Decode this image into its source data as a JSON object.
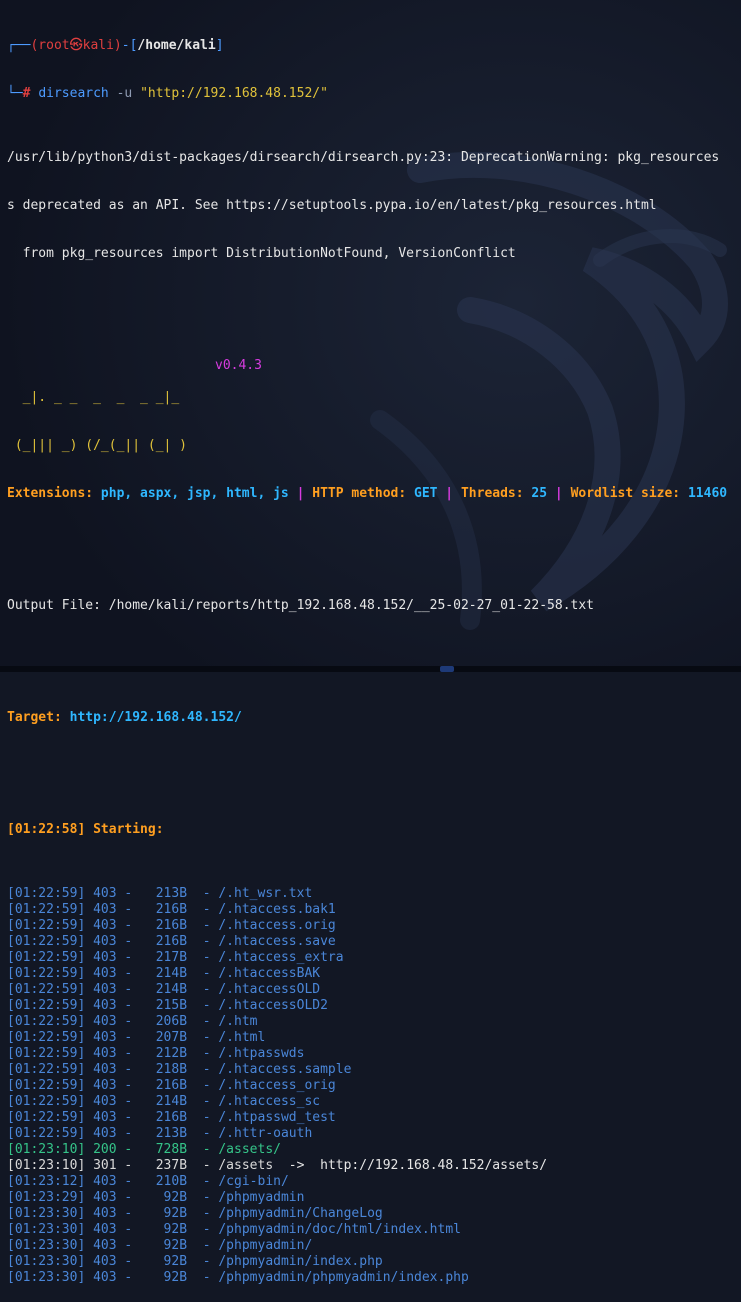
{
  "prompt": {
    "user": "(root㉿kali)",
    "dir": "/home/kali",
    "symbol": "#",
    "command_name": "dirsearch",
    "command_args": " -u ",
    "url_arg": "\"http://192.168.48.152/\""
  },
  "warning_lines": [
    "/usr/lib/python3/dist-packages/dirsearch/dirsearch.py:23: DeprecationWarning: pkg_resources",
    "s deprecated as an API. See https://setuptools.pypa.io/en/latest/pkg_resources.html",
    "  from pkg_resources import DistributionNotFound, VersionConflict"
  ],
  "banner": {
    "art": [
      "  _|. _ _  _  _  _ _|_",
      " (_||| _) (/_(_|| (_| )"
    ],
    "version": "v0.4.3"
  },
  "config": {
    "ext_label": "Extensions: ",
    "ext_value": "php, aspx, jsp, html, js",
    "sep": " | ",
    "method_label": "HTTP method: ",
    "method_value": "GET",
    "threads_label": "Threads: ",
    "threads_value": "25",
    "wordlist_label": "Wordlist size: ",
    "wordlist_value": "11460"
  },
  "output_file": "Output File: /home/kali/reports/http_192.168.48.152/__25-02-27_01-22-58.txt",
  "target": {
    "label": "Target: ",
    "url": "http://192.168.48.152/"
  },
  "starting": "[01:22:58] Starting:",
  "results": [
    {
      "time": "[01:22:59]",
      "code": "403",
      "size": " 213B",
      "path": "/.ht_wsr.txt"
    },
    {
      "time": "[01:22:59]",
      "code": "403",
      "size": " 216B",
      "path": "/.htaccess.bak1"
    },
    {
      "time": "[01:22:59]",
      "code": "403",
      "size": " 216B",
      "path": "/.htaccess.orig"
    },
    {
      "time": "[01:22:59]",
      "code": "403",
      "size": " 216B",
      "path": "/.htaccess.save"
    },
    {
      "time": "[01:22:59]",
      "code": "403",
      "size": " 217B",
      "path": "/.htaccess_extra"
    },
    {
      "time": "[01:22:59]",
      "code": "403",
      "size": " 214B",
      "path": "/.htaccessBAK"
    },
    {
      "time": "[01:22:59]",
      "code": "403",
      "size": " 214B",
      "path": "/.htaccessOLD"
    },
    {
      "time": "[01:22:59]",
      "code": "403",
      "size": " 215B",
      "path": "/.htaccessOLD2"
    },
    {
      "time": "[01:22:59]",
      "code": "403",
      "size": " 206B",
      "path": "/.htm"
    },
    {
      "time": "[01:22:59]",
      "code": "403",
      "size": " 207B",
      "path": "/.html"
    },
    {
      "time": "[01:22:59]",
      "code": "403",
      "size": " 212B",
      "path": "/.htpasswds"
    },
    {
      "time": "[01:22:59]",
      "code": "403",
      "size": " 218B",
      "path": "/.htaccess.sample"
    },
    {
      "time": "[01:22:59]",
      "code": "403",
      "size": " 216B",
      "path": "/.htaccess_orig"
    },
    {
      "time": "[01:22:59]",
      "code": "403",
      "size": " 214B",
      "path": "/.htaccess_sc"
    },
    {
      "time": "[01:22:59]",
      "code": "403",
      "size": " 216B",
      "path": "/.htpasswd_test"
    },
    {
      "time": "[01:22:59]",
      "code": "403",
      "size": " 213B",
      "path": "/.httr-oauth"
    },
    {
      "time": "[01:23:10]",
      "code": "200",
      "size": " 728B",
      "path": "/assets/"
    },
    {
      "time": "[01:23:10]",
      "code": "301",
      "size": " 237B",
      "path": "/assets",
      "redirect": "  ->  http://192.168.48.152/assets/"
    },
    {
      "time": "[01:23:12]",
      "code": "403",
      "size": " 210B",
      "path": "/cgi-bin/"
    },
    {
      "time": "[01:23:29]",
      "code": "403",
      "size": "  92B",
      "path": "/phpmyadmin"
    },
    {
      "time": "[01:23:30]",
      "code": "403",
      "size": "  92B",
      "path": "/phpmyadmin/ChangeLog"
    },
    {
      "time": "[01:23:30]",
      "code": "403",
      "size": "  92B",
      "path": "/phpmyadmin/doc/html/index.html"
    },
    {
      "time": "[01:23:30]",
      "code": "403",
      "size": "  92B",
      "path": "/phpmyadmin/"
    },
    {
      "time": "[01:23:30]",
      "code": "403",
      "size": "  92B",
      "path": "/phpmyadmin/index.php"
    },
    {
      "time": "[01:23:30]",
      "code": "403",
      "size": "  92B",
      "path": "/phpmyadmin/phpmyadmin/index.php"
    }
  ]
}
